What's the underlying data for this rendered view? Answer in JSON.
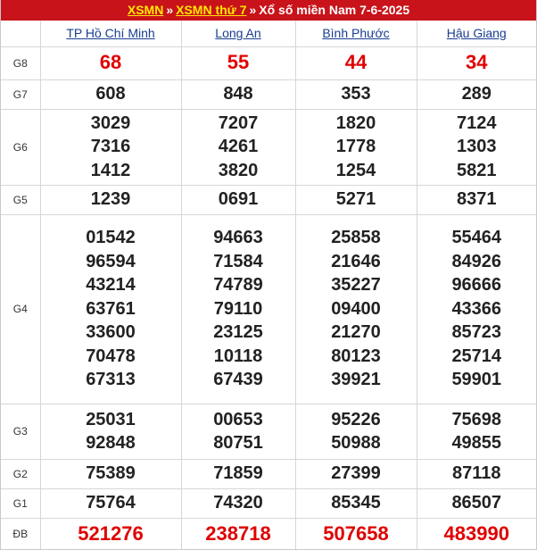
{
  "header": {
    "link1": "XSMN",
    "link2": "XSMN thứ 7",
    "separator": "»",
    "title": "Xổ số miền Nam 7-6-2025"
  },
  "provinces": [
    "TP Hồ Chí Minh",
    "Long An",
    "Bình Phước",
    "Hậu Giang"
  ],
  "prizes": [
    {
      "label": "G8",
      "values": [
        [
          "68"
        ],
        [
          "55"
        ],
        [
          "44"
        ],
        [
          "34"
        ]
      ]
    },
    {
      "label": "G7",
      "values": [
        [
          "608"
        ],
        [
          "848"
        ],
        [
          "353"
        ],
        [
          "289"
        ]
      ]
    },
    {
      "label": "G6",
      "values": [
        [
          "3029",
          "7316",
          "1412"
        ],
        [
          "7207",
          "4261",
          "3820"
        ],
        [
          "1820",
          "1778",
          "1254"
        ],
        [
          "7124",
          "1303",
          "5821"
        ]
      ]
    },
    {
      "label": "G5",
      "values": [
        [
          "1239"
        ],
        [
          "0691"
        ],
        [
          "5271"
        ],
        [
          "8371"
        ]
      ]
    },
    {
      "label": "G4",
      "values": [
        [
          "01542",
          "96594",
          "43214",
          "63761",
          "33600",
          "70478",
          "67313"
        ],
        [
          "94663",
          "71584",
          "74789",
          "79110",
          "23125",
          "10118",
          "67439"
        ],
        [
          "25858",
          "21646",
          "35227",
          "09400",
          "21270",
          "80123",
          "39921"
        ],
        [
          "55464",
          "84926",
          "96666",
          "43366",
          "85723",
          "25714",
          "59901"
        ]
      ]
    },
    {
      "label": "G3",
      "values": [
        [
          "25031",
          "92848"
        ],
        [
          "00653",
          "80751"
        ],
        [
          "95226",
          "50988"
        ],
        [
          "75698",
          "49855"
        ]
      ]
    },
    {
      "label": "G2",
      "values": [
        [
          "75389"
        ],
        [
          "71859"
        ],
        [
          "27399"
        ],
        [
          "87118"
        ]
      ]
    },
    {
      "label": "G1",
      "values": [
        [
          "75764"
        ],
        [
          "74320"
        ],
        [
          "85345"
        ],
        [
          "86507"
        ]
      ]
    },
    {
      "label": "ĐB",
      "values": [
        [
          "521276"
        ],
        [
          "238718"
        ],
        [
          "507658"
        ],
        [
          "483990"
        ]
      ]
    }
  ]
}
